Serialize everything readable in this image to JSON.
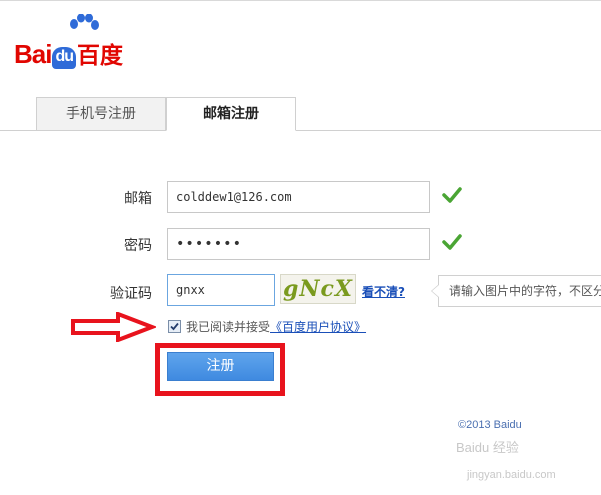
{
  "logo": {
    "text_bai": "Bai",
    "text_du": "du",
    "text_cn": "百度",
    "brand_color": "#e10601",
    "paw_color": "#2f6bd8"
  },
  "tabs": [
    {
      "label": "手机号注册",
      "active": false
    },
    {
      "label": "邮箱注册",
      "active": true
    }
  ],
  "form": {
    "email": {
      "label": "邮箱",
      "value": "colddew1@126.com",
      "valid": true
    },
    "password": {
      "label": "密码",
      "value": "•••••••",
      "valid": true
    },
    "captcha": {
      "label": "验证码",
      "value": "gnxx",
      "image_text": "gNcX",
      "refresh_label": "看不清?",
      "hint": "请输入图片中的字符，不区分"
    },
    "agreement": {
      "checked": true,
      "text": "我已阅读并接受",
      "link": "《百度用户协议》"
    },
    "submit_label": "注册"
  },
  "annotation": {
    "arrow_color": "#e8131d",
    "box_color": "#e8131d"
  },
  "footer": {
    "copyright": "©2013 Baidu",
    "watermark": "Baidu 经验",
    "watermark_sub": "jingyan.baidu.com"
  }
}
